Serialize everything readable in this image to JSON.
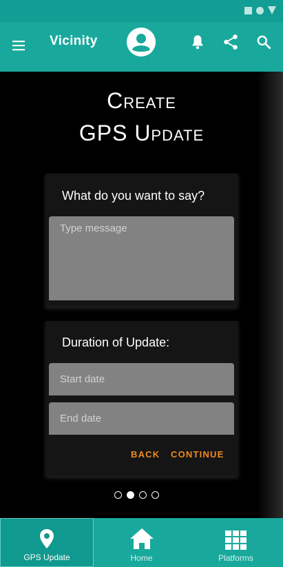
{
  "app_bar": {
    "title": "Vicinity"
  },
  "page": {
    "title_line1": "Create",
    "title_line2": "GPS Update"
  },
  "message_card": {
    "heading": "What do you want to say?",
    "placeholder": "Type message"
  },
  "duration_card": {
    "heading": "Duration of Update:",
    "start_placeholder": "Start date",
    "end_placeholder": "End date",
    "back_label": "BACK",
    "continue_label": "CONTINUE"
  },
  "stepper": {
    "total": 4,
    "active": 2
  },
  "bottom_nav": [
    {
      "label": "GPS Update",
      "icon": "location-pin-icon",
      "selected": true
    },
    {
      "label": "Home",
      "icon": "home-icon",
      "selected": false
    },
    {
      "label": "Platforms",
      "icon": "grid-icon",
      "selected": false
    }
  ],
  "colors": {
    "primary": "#18a99c",
    "accent": "#f08a1c",
    "card": "#151515",
    "field": "#828282"
  }
}
